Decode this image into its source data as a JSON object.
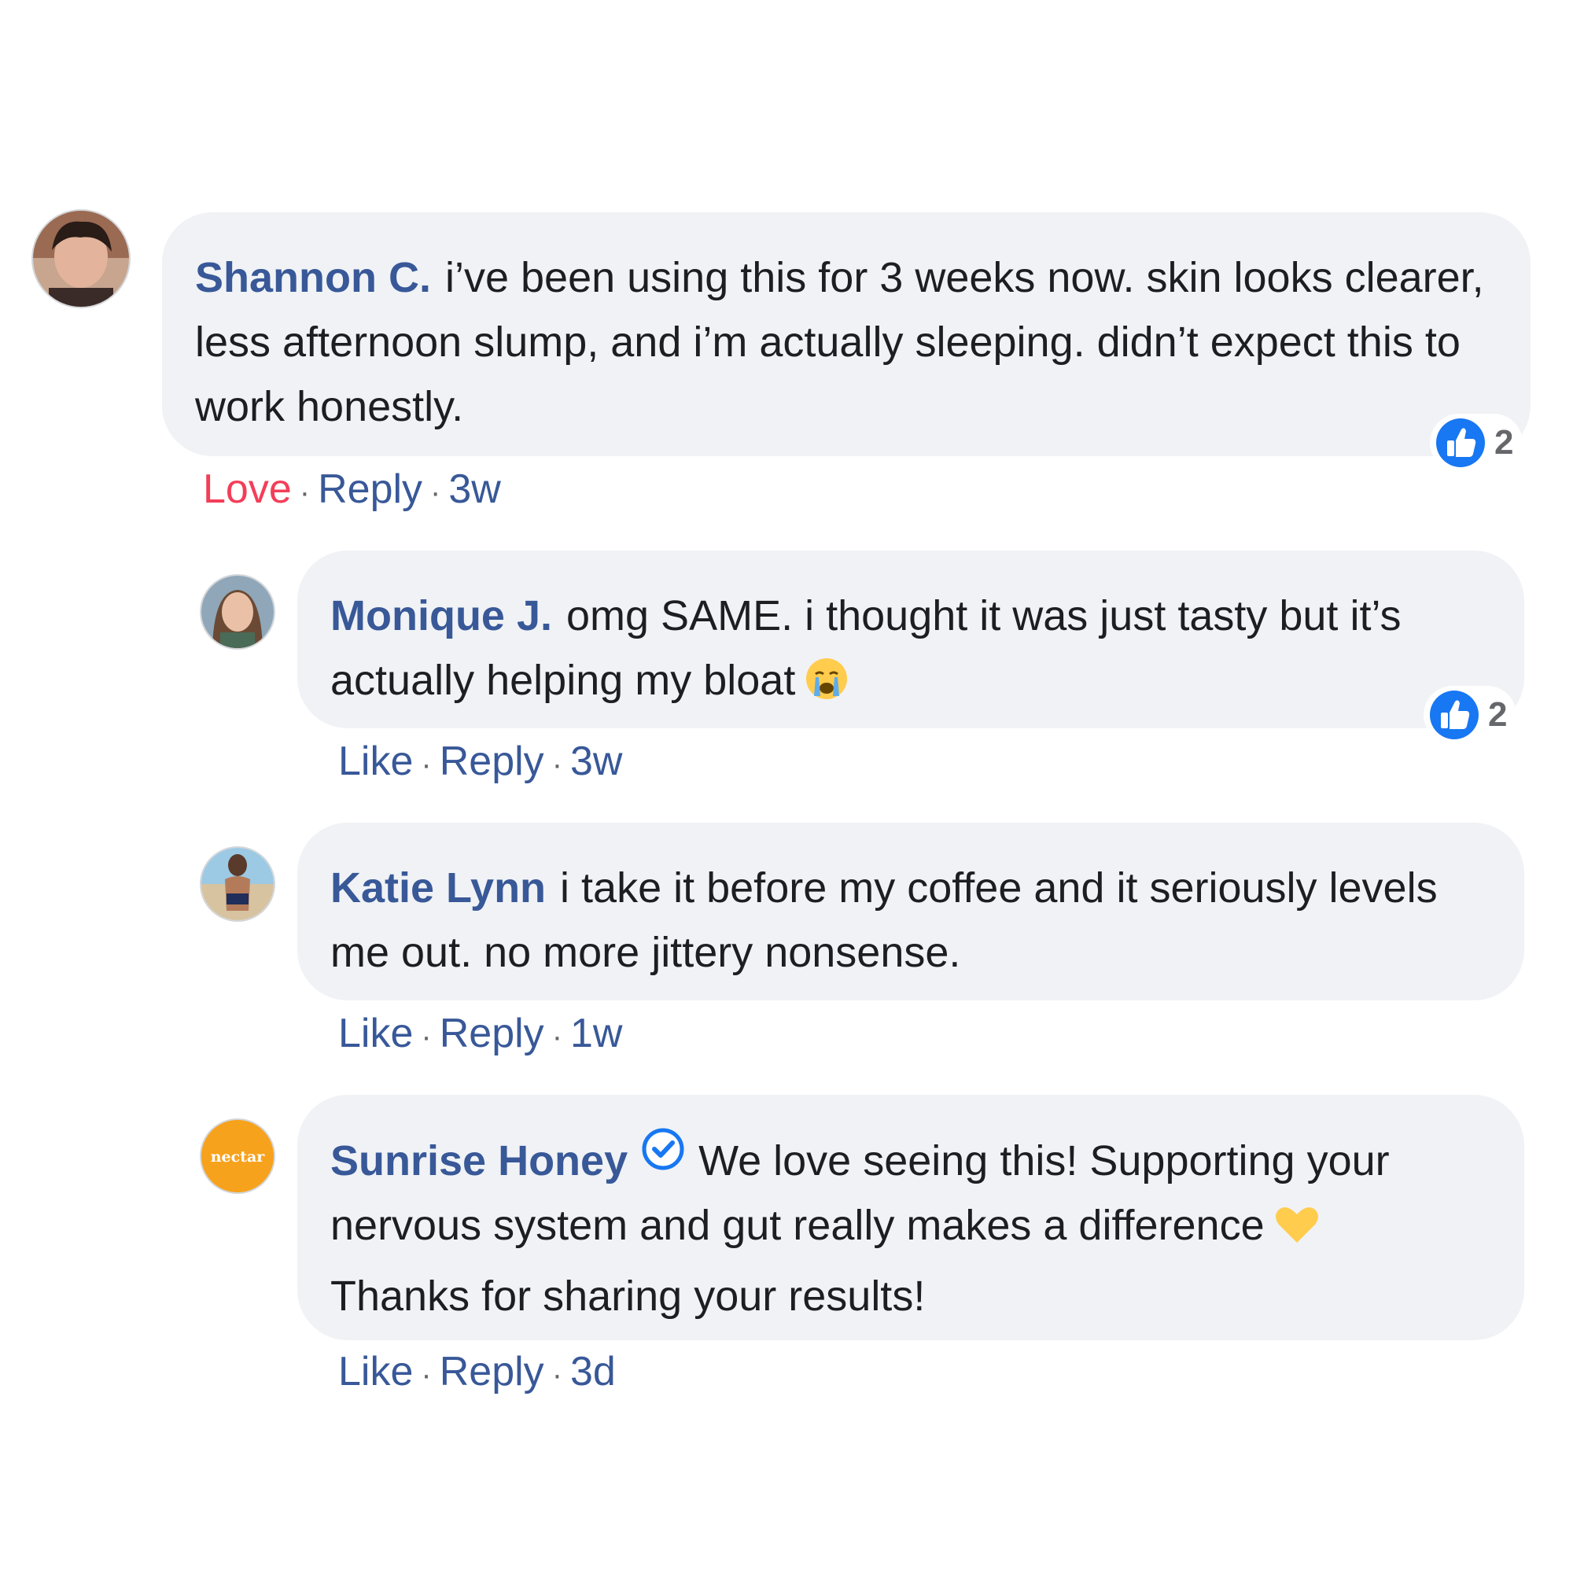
{
  "colors": {
    "author": "#385898",
    "bubble": "#f0f2f5",
    "love": "#f33e58",
    "like_badge": "#1877f2",
    "brand_avatar": "#f7a21c"
  },
  "comments": [
    {
      "author": "Shannon C.",
      "text": "i’ve been using this for 3 weeks now. skin looks clearer, less afternoon slump, and i’m actually sleeping. didn’t expect this to work honestly.",
      "reaction_label": "Love",
      "reply_label": "Reply",
      "time": "3w",
      "reaction_count": "2",
      "reaction_icon": "thumbs-up-icon"
    },
    {
      "author": "Monique J.",
      "text": "omg SAME. i thought it was just tasty but it’s actually helping my bloat",
      "emoji": "crying-face-emoji",
      "reaction_label": "Like",
      "reply_label": "Reply",
      "time": "3w",
      "reaction_count": "2",
      "reaction_icon": "thumbs-up-icon"
    },
    {
      "author": "Katie Lynn",
      "text": "i take it before my coffee and it seriously levels me out. no more jittery nonsense.",
      "reaction_label": "Like",
      "reply_label": "Reply",
      "time": "1w"
    },
    {
      "author": "Sunrise Honey",
      "verified": true,
      "avatar_text": "nectar",
      "text_part1": "We love seeing this! Supporting your nervous system and gut really makes a difference",
      "emoji": "yellow-heart-emoji",
      "text_part2": "Thanks for sharing your results!",
      "reaction_label": "Like",
      "reply_label": "Reply",
      "time": "3d"
    }
  ]
}
